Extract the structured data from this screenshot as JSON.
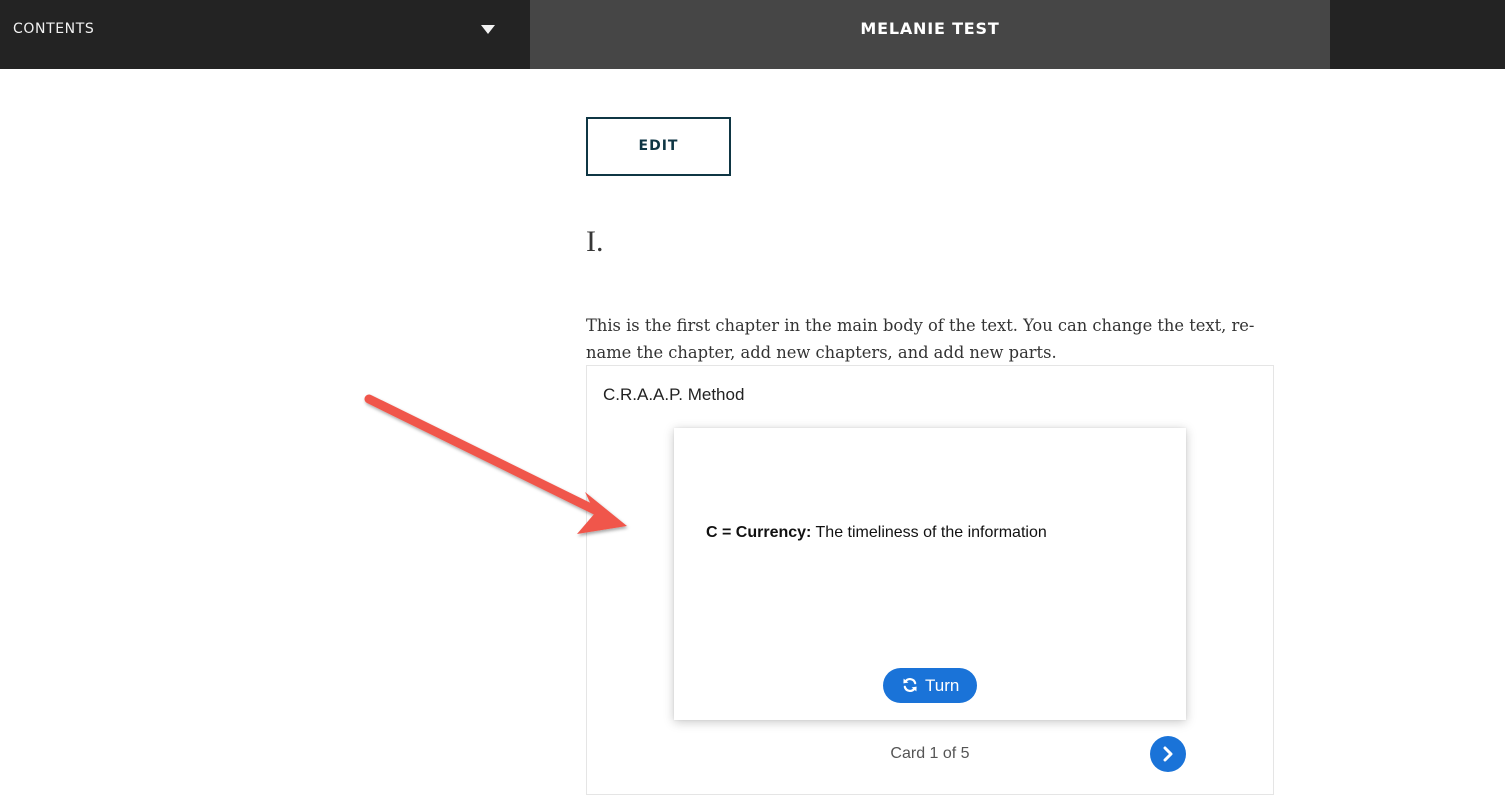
{
  "header": {
    "contents_label": "CONTENTS",
    "book_title": "MELANIE TEST"
  },
  "main": {
    "edit_label": "EDIT",
    "chapter_number": "I.",
    "intro_text": "This is the first chapter in the main body of the text. You can change the text, re-name the chapter, add new chapters, and add new parts."
  },
  "flashcards": {
    "title": "C.R.A.A.P. Method",
    "card": {
      "term": "C = Currency:",
      "definition": "The timeliness of the information"
    },
    "turn_label": "Turn",
    "counter": "Card 1 of 5",
    "current_card": 1,
    "total_cards": 5
  },
  "colors": {
    "topbar": "#232323",
    "title_bar": "#464646",
    "accent_blue": "#1a73d8",
    "edit_border": "#0f3644",
    "annotation_arrow": "#f0574b"
  },
  "icons": {
    "contents_caret": "caret-down-icon",
    "turn": "refresh-icon",
    "next": "chevron-right-icon"
  }
}
